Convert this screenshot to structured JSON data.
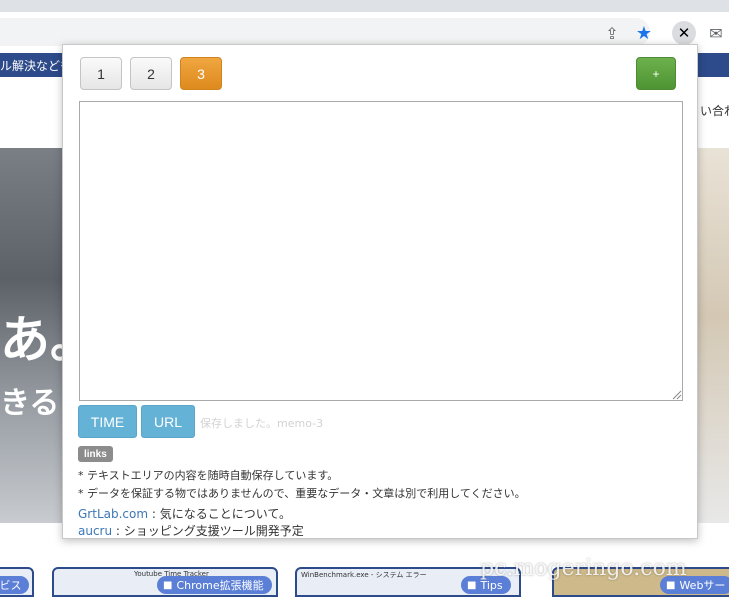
{
  "browser": {
    "toolbar_icons": [
      "share-icon",
      "star-icon",
      "extension-icon",
      "mail-icon"
    ],
    "accent_color": "#1a73e8"
  },
  "background_page": {
    "nav_text": "ル解決なども",
    "right_text": "い合わ",
    "hero_text_1": "あ。",
    "hero_text_2": "きるソ",
    "cards": [
      {
        "thumb_text": "",
        "tag": "ビス"
      },
      {
        "thumb_text": "Youtube Time Tracker",
        "tag": "Chrome拡張機能"
      },
      {
        "thumb_text": "WinBenchmark.exe - システム エラー",
        "tag": "Tips"
      },
      {
        "thumb_text": "",
        "tag": "Webサー"
      }
    ],
    "watermark": "pc.mogeringo.com",
    "nav_color": "#2d4a8a"
  },
  "popup": {
    "tabs": [
      {
        "label": "1",
        "active": false
      },
      {
        "label": "2",
        "active": false
      },
      {
        "label": "3",
        "active": true
      }
    ],
    "add_label": "+",
    "memo_value": "",
    "time_label": "TIME",
    "url_label": "URL",
    "status_text": "保存しました。memo-3",
    "links_label": "links",
    "notes": [
      "* テキストエリアの内容を随時自動保存しています。",
      "* データを保証する物ではありませんので、重要なデータ・文章は別で利用してください。"
    ],
    "links": [
      {
        "name": "GrtLab.com",
        "desc": " : 気になることについて。"
      },
      {
        "name": "aucru",
        "desc": " : ショッピング支援ツール開発予定"
      }
    ],
    "colors": {
      "active_tab": "#e09422",
      "add_button": "#5ca33f",
      "action_button": "#64b2d6",
      "link": "#3d77b6"
    }
  }
}
